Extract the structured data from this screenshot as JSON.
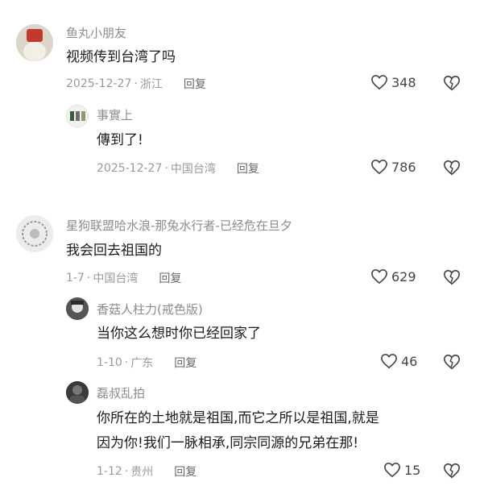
{
  "comments": [
    {
      "username": "鱼丸小朋友",
      "text": [
        "视频传到台湾了吗"
      ],
      "date": "2025-12-27",
      "location": "浙江",
      "reply_label": "回复",
      "likes": "348"
    },
    {
      "username": "事實上",
      "text": [
        "傳到了!"
      ],
      "date": "2025-12-27",
      "location": "中国台湾",
      "reply_label": "回复",
      "likes": "786"
    },
    {
      "username": "星狗联盟哈水浪-那兔水行者-已经危在旦夕",
      "text": [
        "我会回去祖国的"
      ],
      "date": "1-7",
      "location": "中国台湾",
      "reply_label": "回复",
      "likes": "629"
    },
    {
      "username": "香菇人柱力(戒色版)",
      "text": [
        "当你这么想时你已经回家了"
      ],
      "date": "1-10",
      "location": "广东",
      "reply_label": "回复",
      "likes": "46"
    },
    {
      "username": "磊叔乱拍",
      "text": [
        "你所在的土地就是祖国,而它之所以是祖国,就是",
        "因为你!我们一脉相承,同宗同源的兄弟在那!"
      ],
      "date": "1-12",
      "location": "贵州",
      "reply_label": "回复",
      "likes": "15"
    }
  ],
  "separator": "·",
  "icons": {
    "like": "heart-outline-icon",
    "dislike": "broken-heart-icon"
  }
}
